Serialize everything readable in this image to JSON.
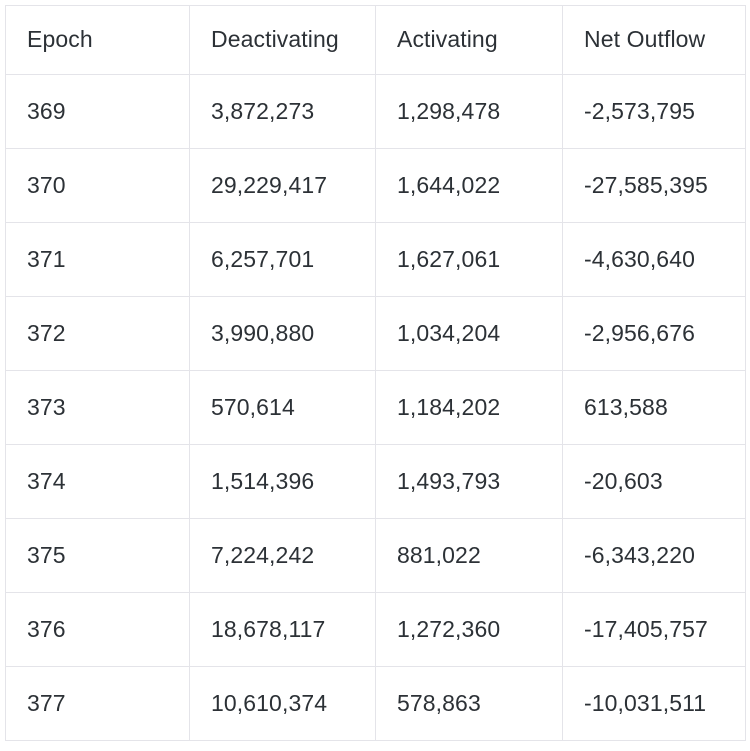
{
  "table": {
    "columns": [
      "Epoch",
      "Deactivating",
      "Activating",
      "Net Outflow"
    ],
    "rows": [
      {
        "epoch": "369",
        "deactivating": "3,872,273",
        "activating": "1,298,478",
        "net_outflow": "-2,573,795"
      },
      {
        "epoch": "370",
        "deactivating": "29,229,417",
        "activating": "1,644,022",
        "net_outflow": "-27,585,395"
      },
      {
        "epoch": "371",
        "deactivating": "6,257,701",
        "activating": "1,627,061",
        "net_outflow": "-4,630,640"
      },
      {
        "epoch": "372",
        "deactivating": "3,990,880",
        "activating": "1,034,204",
        "net_outflow": "-2,956,676"
      },
      {
        "epoch": "373",
        "deactivating": "570,614",
        "activating": "1,184,202",
        "net_outflow": "613,588"
      },
      {
        "epoch": "374",
        "deactivating": "1,514,396",
        "activating": "1,493,793",
        "net_outflow": "-20,603"
      },
      {
        "epoch": "375",
        "deactivating": "7,224,242",
        "activating": "881,022",
        "net_outflow": "-6,343,220"
      },
      {
        "epoch": "376",
        "deactivating": "18,678,117",
        "activating": "1,272,360",
        "net_outflow": "-17,405,757"
      },
      {
        "epoch": "377",
        "deactivating": "10,610,374",
        "activating": "578,863",
        "net_outflow": "-10,031,511"
      }
    ]
  },
  "style": {
    "text_color": "#2c3136",
    "border_color": "#e4e4e9",
    "background_color": "#ffffff"
  }
}
